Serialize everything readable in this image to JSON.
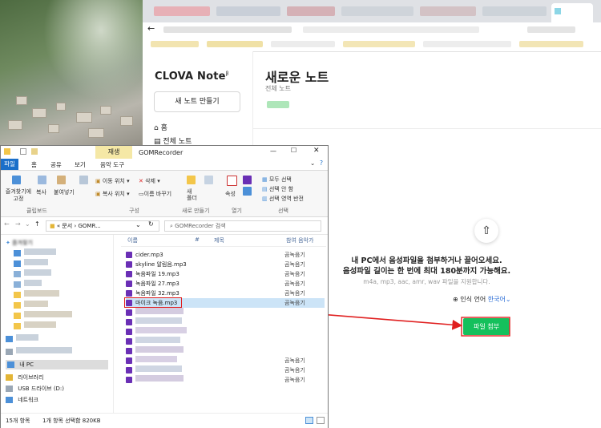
{
  "browser": {
    "nav_back": "←",
    "menu_dots": "⋮"
  },
  "clova": {
    "logo": "CLOVA Note",
    "logo_mark": "β",
    "new_note_button": "새 노트 만들기",
    "sidebar": [
      {
        "icon": "home-icon",
        "label": "홈"
      },
      {
        "icon": "notes-icon",
        "label": "전체 노트"
      }
    ],
    "main_title": "새로운 노트",
    "breadcrumb": "전체 노트",
    "upload_icon": "⇧",
    "drop_text_1": "내 PC에서 음성파일을 첨부하거나 끌어오세요.",
    "drop_text_2": "음성파일 길이는 한 번에 최대 180분까지 가능해요.",
    "formats_text": "m4a, mp3, aac, amr, wav 파일을 지원합니다.",
    "lang_label": "인식 언어",
    "lang_value": "한국어",
    "attach_button": "파일 첨부"
  },
  "explorer": {
    "title": "GOMRecorder",
    "context_tab": "재생",
    "menu": {
      "file": "파일",
      "home": "홈",
      "share": "공유",
      "view": "보기",
      "music_tools": "음악 도구"
    },
    "ribbon": {
      "pin_quick": "즐겨찾기에\n고정",
      "copy": "복사",
      "paste": "붙여넣기",
      "clipboard_group": "클립보드",
      "move_to": "이동 위치",
      "copy_to": "복사 위치",
      "delete": "삭제",
      "rename": "이름 바꾸기",
      "organize_group": "구성",
      "new_folder": "새\n폴더",
      "new_group": "새로 만들기",
      "properties": "속성",
      "open_group": "열기",
      "select_all": "모두 선택",
      "select_none": "선택 안 함",
      "invert_selection": "선택 영역 반전",
      "select_group": "선택"
    },
    "path": "« 문서 › GOMR...",
    "search_placeholder": "GOMRecorder 검색",
    "columns": {
      "name": "이름",
      "num": "#",
      "title": "제목",
      "artist": "참여 음악가"
    },
    "nav_items": [
      {
        "label": "즐겨찾기",
        "icon": "star-icon"
      },
      {
        "label": "내 PC",
        "icon": "pc-icon"
      },
      {
        "label": "라이브러리",
        "icon": "library-icon"
      },
      {
        "label": "USB 드라이브 (D:)",
        "icon": "usb-icon"
      },
      {
        "label": "네트워크",
        "icon": "network-icon"
      }
    ],
    "files": [
      {
        "name": "cider.mp3",
        "artist": "곰녹음기"
      },
      {
        "name": "skyline 알림음.mp3",
        "artist": "곰녹음기"
      },
      {
        "name": "녹음파일 19.mp3",
        "artist": "곰녹음기"
      },
      {
        "name": "녹음파일 27.mp3",
        "artist": "곰녹음기"
      },
      {
        "name": "녹음파일 32.mp3",
        "artist": "곰녹음기"
      },
      {
        "name": "마이크 녹음.mp3",
        "artist": "곰녹음기"
      }
    ],
    "blurred_artist_rows": [
      "곰녹음기",
      "곰녹음기",
      "곰녹음기"
    ],
    "status_items": "15개 항목",
    "status_selected": "1개 항목 선택함 820KB"
  },
  "colors": {
    "attach_green": "#15c05c",
    "file_blue": "#1a6fc9",
    "highlight_red": "#e02020",
    "context_yellow": "#f5e8a6"
  }
}
